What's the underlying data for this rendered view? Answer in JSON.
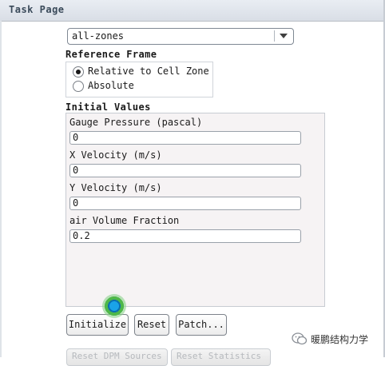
{
  "window": {
    "title": "Task Page"
  },
  "zone_select": {
    "value": "all-zones"
  },
  "reference_frame": {
    "title": "Reference Frame",
    "options": [
      {
        "label": "Relative to Cell Zone",
        "selected": true
      },
      {
        "label": "Absolute",
        "selected": false
      }
    ]
  },
  "initial_values": {
    "title": "Initial Values",
    "fields": [
      {
        "label": "Gauge Pressure (pascal)",
        "value": "0"
      },
      {
        "label": "X Velocity (m/s)",
        "value": "0"
      },
      {
        "label": "Y Velocity (m/s)",
        "value": "0"
      },
      {
        "label": "air Volume Fraction",
        "value": "0.2"
      }
    ]
  },
  "buttons": {
    "initialize": "Initialize",
    "reset": "Reset",
    "patch": "Patch..."
  },
  "hidden_buttons": {
    "left": "Reset DPM Sources",
    "right": "Reset Statistics"
  },
  "watermark": {
    "text": "暖鹏结构力学"
  },
  "colors": {
    "cursor_highlight": "#1aa3e8",
    "cursor_ring": "#4fb84a"
  }
}
